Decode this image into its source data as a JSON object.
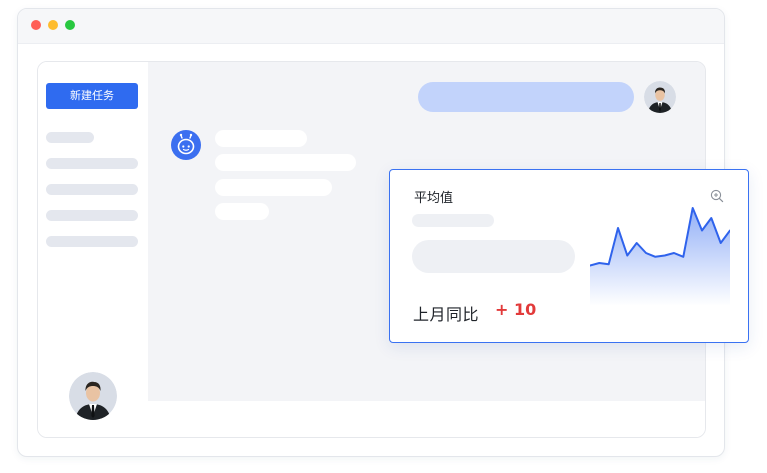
{
  "window": {
    "controls": [
      "close",
      "minimize",
      "maximize"
    ]
  },
  "sidebar": {
    "new_task_label": "新建任务",
    "placeholder_items": 5
  },
  "chat": {
    "bot_icon": "robot-icon",
    "user_avatar": "user-avatar"
  },
  "card": {
    "title": "平均值",
    "zoom_icon": "zoom-in-icon",
    "compare_label": "上月同比",
    "compare_value": "+ 10",
    "accent_color": "#3a72f2",
    "positive_color": "#e23a3a"
  },
  "sparkline": {
    "values": [
      2,
      4,
      3,
      32,
      10,
      20,
      12,
      9,
      10,
      12,
      9,
      48,
      30,
      40,
      20,
      30
    ]
  }
}
